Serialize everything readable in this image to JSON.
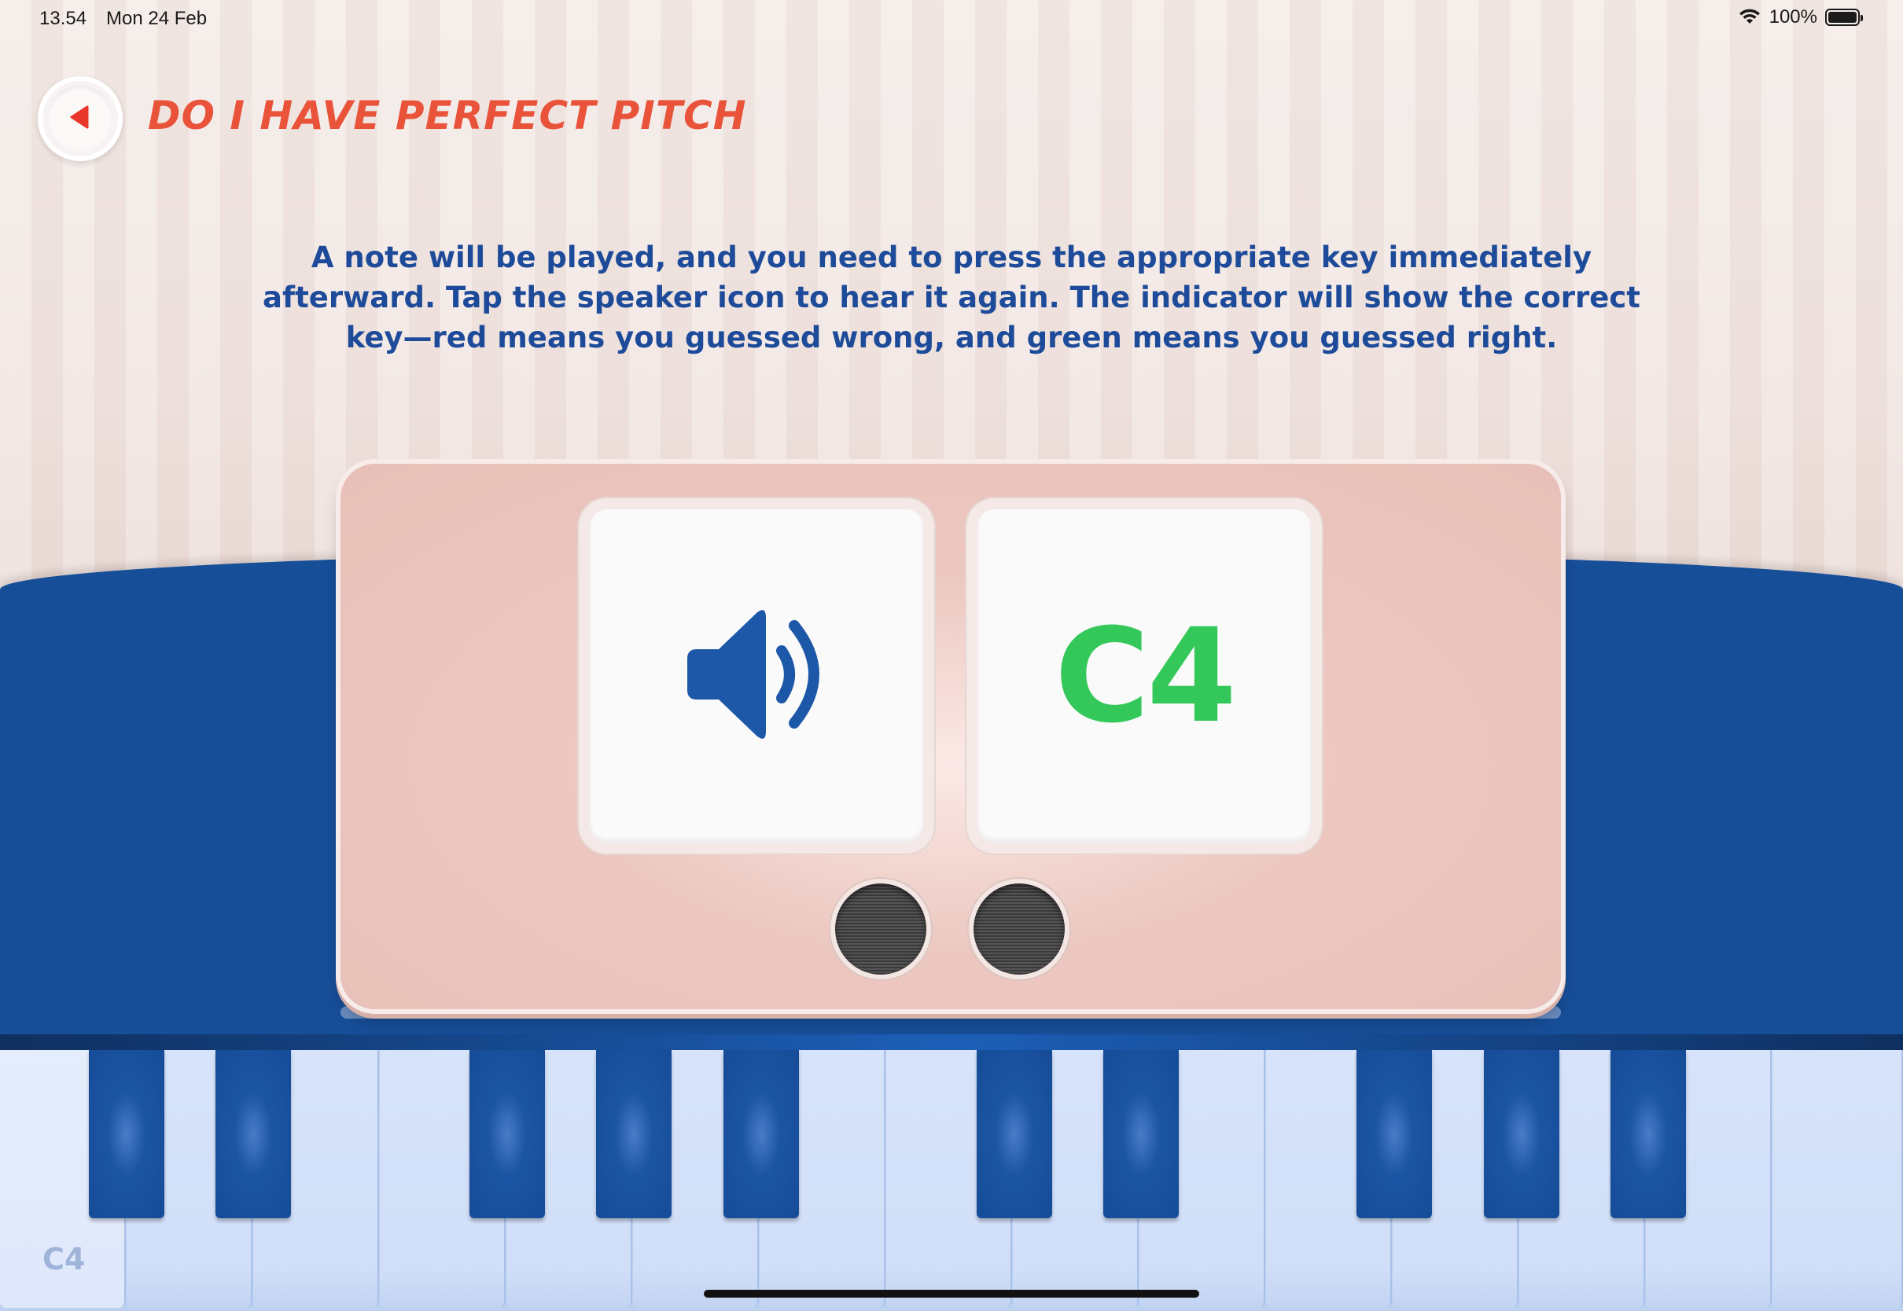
{
  "status_bar": {
    "time": "13.54",
    "date": "Mon 24 Feb",
    "battery_percent": "100%",
    "wifi_icon": "wifi-icon",
    "battery_icon": "battery-full-icon"
  },
  "header": {
    "back_icon": "back-arrow-icon",
    "title": "DO I HAVE PERFECT PITCH"
  },
  "instructions": "A note will be played, and you need to press the appropriate key immediately afterward. Tap the speaker icon to hear it again. The indicator will show the correct key—red means you guessed wrong, and green means you guessed right.",
  "display": {
    "speaker_icon": "speaker-volume-icon",
    "note_indicator": "C4",
    "note_indicator_color": "#34c759"
  },
  "keyboard": {
    "highlighted_key_label": "C4",
    "accent_blue": "#174e98"
  },
  "colors": {
    "title": "#e9533a",
    "text": "#1d4b9a",
    "panel": "#e8c0b8"
  }
}
